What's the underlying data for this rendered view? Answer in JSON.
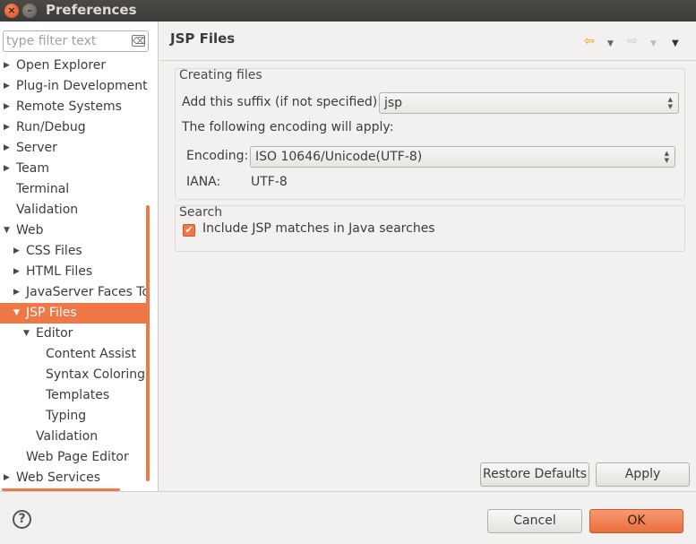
{
  "window": {
    "title": "Preferences",
    "close_glyph": "×",
    "minimize_glyph": "–"
  },
  "sidebar": {
    "filter_placeholder": "type filter text",
    "filter_clear_glyph": "⌫",
    "items": [
      {
        "label": "Open Explorer",
        "depth": 0,
        "arrow": "▶"
      },
      {
        "label": "Plug-in Development",
        "depth": 0,
        "arrow": "▶"
      },
      {
        "label": "Remote Systems",
        "depth": 0,
        "arrow": "▶"
      },
      {
        "label": "Run/Debug",
        "depth": 0,
        "arrow": "▶"
      },
      {
        "label": "Server",
        "depth": 0,
        "arrow": "▶"
      },
      {
        "label": "Team",
        "depth": 0,
        "arrow": "▶"
      },
      {
        "label": "Terminal",
        "depth": 0,
        "arrow": ""
      },
      {
        "label": "Validation",
        "depth": 0,
        "arrow": ""
      },
      {
        "label": "Web",
        "depth": 0,
        "arrow": "▼"
      },
      {
        "label": "CSS Files",
        "depth": 1,
        "arrow": "▶"
      },
      {
        "label": "HTML Files",
        "depth": 1,
        "arrow": "▶"
      },
      {
        "label": "JavaServer Faces Tools",
        "depth": 1,
        "arrow": "▶"
      },
      {
        "label": "JSP Files",
        "depth": 1,
        "arrow": "▼",
        "selected": true
      },
      {
        "label": "Editor",
        "depth": 2,
        "arrow": "▼"
      },
      {
        "label": "Content Assist",
        "depth": 3,
        "arrow": ""
      },
      {
        "label": "Syntax Coloring",
        "depth": 3,
        "arrow": ""
      },
      {
        "label": "Templates",
        "depth": 3,
        "arrow": ""
      },
      {
        "label": "Typing",
        "depth": 3,
        "arrow": ""
      },
      {
        "label": "Validation",
        "depth": 2,
        "arrow": ""
      },
      {
        "label": "Web Page Editor",
        "depth": 1,
        "arrow": ""
      },
      {
        "label": "Web Services",
        "depth": 0,
        "arrow": "▶"
      }
    ]
  },
  "page": {
    "title": "JSP Files",
    "nav_back_glyph": "⇦",
    "nav_forward_glyph": "⇨",
    "dropdown_glyph": "▼",
    "creating_files": {
      "title": "Creating files",
      "suffix_label": "Add this suffix (if not specified):",
      "suffix_value": "jsp",
      "encoding_intro": "The following encoding will apply:",
      "encoding_label": "Encoding:",
      "encoding_value": "ISO 10646/Unicode(UTF-8)",
      "iana_label": "IANA:",
      "iana_value": "UTF-8"
    },
    "search": {
      "title": "Search",
      "include_label": "Include JSP matches in Java searches",
      "include_checked": true,
      "check_glyph": "✔"
    },
    "restore_label": "Restore Defaults",
    "apply_label": "Apply"
  },
  "footer": {
    "help_glyph": "?",
    "cancel_label": "Cancel",
    "ok_label": "OK"
  },
  "colors": {
    "accent": "#f07746",
    "titlebar": "#3c3b37",
    "background": "#f2f1f0"
  }
}
